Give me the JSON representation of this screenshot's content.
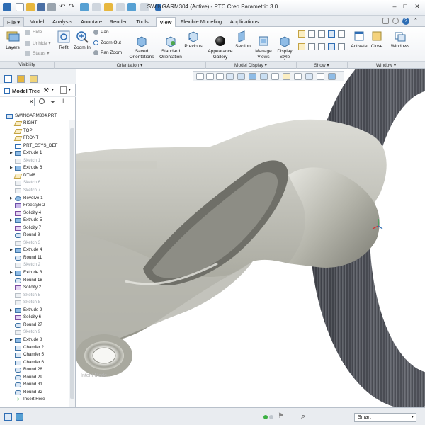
{
  "window": {
    "title": "SWINGARM304 (Active) - PTC Creo Parametric 3.0"
  },
  "tabs": [
    "File",
    "Model",
    "Analysis",
    "Annotate",
    "Render",
    "Tools",
    "View",
    "Flexible Modeling",
    "Applications"
  ],
  "active_tab": "View",
  "ribbon": {
    "visibility": {
      "layers": "Layers",
      "hide": "Hide",
      "unhide": "Unhide",
      "status": "Status"
    },
    "orientation": {
      "refit": "Refit",
      "zoom_in": "Zoom In",
      "pan": "Pan",
      "zoom_out": "Zoom Out",
      "pan_zoom": "Pan Zoom",
      "saved_orientations": "Saved\nOrientations",
      "standard_orientation": "Standard\nOrientation",
      "previous": "Previous"
    },
    "model_display": {
      "appearance_gallery": "Appearance\nGallery",
      "section": "Section",
      "manage_views": "Manage\nViews",
      "display_style": "Display\nStyle"
    },
    "window": {
      "activate": "Activate",
      "close": "Close",
      "windows": "Windows"
    },
    "groups": [
      "Visibility",
      "Orientation",
      "Model Display",
      "Show",
      "Window"
    ]
  },
  "model_tree": {
    "title": "Model Tree",
    "root": "SWINGARM304.PRT",
    "items": [
      {
        "label": "RIGHT",
        "icon": "datum-plane",
        "expand": false,
        "suppressed": false
      },
      {
        "label": "TOP",
        "icon": "datum-plane",
        "expand": false,
        "suppressed": false
      },
      {
        "label": "FRONT",
        "icon": "datum-plane",
        "expand": false,
        "suppressed": false
      },
      {
        "label": "PRT_CSYS_DEF",
        "icon": "csys",
        "expand": false,
        "suppressed": false
      },
      {
        "label": "Extrude 1",
        "icon": "extrude",
        "expand": true,
        "suppressed": false
      },
      {
        "label": "Sketch 1",
        "icon": "sketch",
        "expand": false,
        "suppressed": true
      },
      {
        "label": "Extrude 6",
        "icon": "extrude",
        "expand": true,
        "suppressed": false
      },
      {
        "label": "DTM8",
        "icon": "datum-plane",
        "expand": false,
        "suppressed": false
      },
      {
        "label": "Sketch 6",
        "icon": "sketch",
        "expand": false,
        "suppressed": true
      },
      {
        "label": "Sketch 7",
        "icon": "sketch",
        "expand": false,
        "suppressed": true
      },
      {
        "label": "Revolve 1",
        "icon": "revolve",
        "expand": true,
        "suppressed": false
      },
      {
        "label": "Freestyle 2",
        "icon": "freestyle",
        "expand": false,
        "suppressed": false
      },
      {
        "label": "Solidify 4",
        "icon": "solidify",
        "expand": false,
        "suppressed": false
      },
      {
        "label": "Extrude 5",
        "icon": "extrude",
        "expand": true,
        "suppressed": false
      },
      {
        "label": "Solidify 7",
        "icon": "solidify",
        "expand": false,
        "suppressed": false
      },
      {
        "label": "Round 9",
        "icon": "round",
        "expand": false,
        "suppressed": false
      },
      {
        "label": "Sketch 3",
        "icon": "sketch",
        "expand": false,
        "suppressed": true
      },
      {
        "label": "Extrude 4",
        "icon": "extrude",
        "expand": true,
        "suppressed": false
      },
      {
        "label": "Round 11",
        "icon": "round",
        "expand": false,
        "suppressed": false
      },
      {
        "label": "Sketch 2",
        "icon": "sketch",
        "expand": false,
        "suppressed": true
      },
      {
        "label": "Extrude 3",
        "icon": "extrude",
        "expand": true,
        "suppressed": false
      },
      {
        "label": "Round 18",
        "icon": "round",
        "expand": false,
        "suppressed": false
      },
      {
        "label": "Solidify 2",
        "icon": "solidify",
        "expand": false,
        "suppressed": false
      },
      {
        "label": "Sketch 5",
        "icon": "sketch",
        "expand": false,
        "suppressed": true
      },
      {
        "label": "Sketch 8",
        "icon": "sketch",
        "expand": false,
        "suppressed": true
      },
      {
        "label": "Extrude 9",
        "icon": "extrude",
        "expand": true,
        "suppressed": false
      },
      {
        "label": "Solidify 6",
        "icon": "solidify",
        "expand": false,
        "suppressed": false
      },
      {
        "label": "Round 27",
        "icon": "round",
        "expand": false,
        "suppressed": false
      },
      {
        "label": "Sketch 9",
        "icon": "sketch",
        "expand": false,
        "suppressed": true
      },
      {
        "label": "Extrude 8",
        "icon": "extrude",
        "expand": true,
        "suppressed": false
      },
      {
        "label": "Chamfer 2",
        "icon": "chamfer",
        "expand": false,
        "suppressed": false
      },
      {
        "label": "Chamfer 5",
        "icon": "chamfer",
        "expand": false,
        "suppressed": false
      },
      {
        "label": "Chamfer 6",
        "icon": "chamfer",
        "expand": false,
        "suppressed": false
      },
      {
        "label": "Round 28",
        "icon": "round",
        "expand": false,
        "suppressed": false
      },
      {
        "label": "Round 29",
        "icon": "round",
        "expand": false,
        "suppressed": false
      },
      {
        "label": "Round 31",
        "icon": "round",
        "expand": false,
        "suppressed": false
      },
      {
        "label": "Round 32",
        "icon": "round",
        "expand": false,
        "suppressed": false
      },
      {
        "label": "Insert Here",
        "icon": "insert-arrow",
        "expand": false,
        "suppressed": false
      }
    ]
  },
  "graphics": {
    "watermark": "Intent Mode"
  },
  "status": {
    "filter": "Smart"
  },
  "colors": {
    "accent": "#2e6db4",
    "ribbon_bg": "#f1f3f6",
    "model_surface": "#b9b9b1",
    "tire": "#3b3d44"
  }
}
